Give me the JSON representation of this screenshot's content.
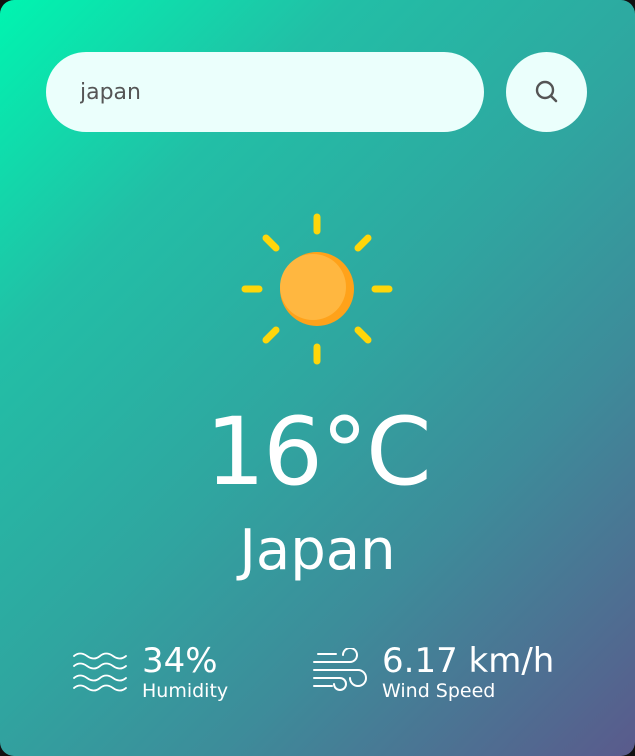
{
  "search": {
    "value": "japan",
    "icon": "search-icon"
  },
  "weather": {
    "icon": "sun-icon",
    "temperature": "16°C",
    "city": "Japan"
  },
  "humidity": {
    "icon": "waves-icon",
    "value": "34%",
    "label": "Humidity"
  },
  "wind": {
    "icon": "wind-icon",
    "value": "6.17 km/h",
    "label": "Wind Speed"
  },
  "colors": {
    "gradient_start": "#00f5b0",
    "gradient_end": "#5a5a8c",
    "input_bg": "#ebfffc",
    "sun_core": "#ffb02e",
    "sun_rays": "#ffd60a"
  }
}
